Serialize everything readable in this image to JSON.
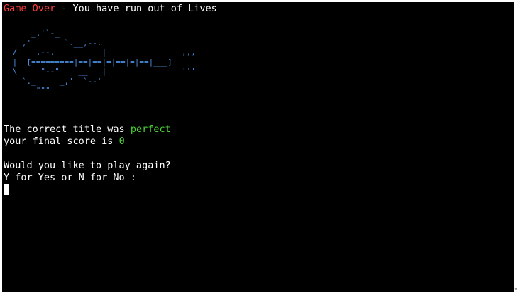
{
  "terminal": {
    "line1": {
      "label": "Game Over",
      "rest": " - You have run out of Lives"
    },
    "guitar_ascii": [
      "     _,'`-_",
      "   ,'       `.__,--.",
      " /    .--.          |                ,,,",
      " |  [=========|==|==|=|==|=|==|___]",
      " \\     \"--\"    __   |                '''",
      "   `._     _,'  `--'",
      "      \"\"\""
    ],
    "line_result": {
      "prefix": "The correct title was ",
      "answer": "perfect"
    },
    "line_score": {
      "prefix": "your final score is ",
      "value": "0"
    },
    "prompt_question": "Would you like to play again?",
    "prompt_options": "Y for Yes or N for No :"
  },
  "colors": {
    "background": "#000000",
    "text": "#ffffff",
    "game_over": "#ff3b3b",
    "ascii_art": "#4a8fe0",
    "highlight": "#4cd137"
  }
}
